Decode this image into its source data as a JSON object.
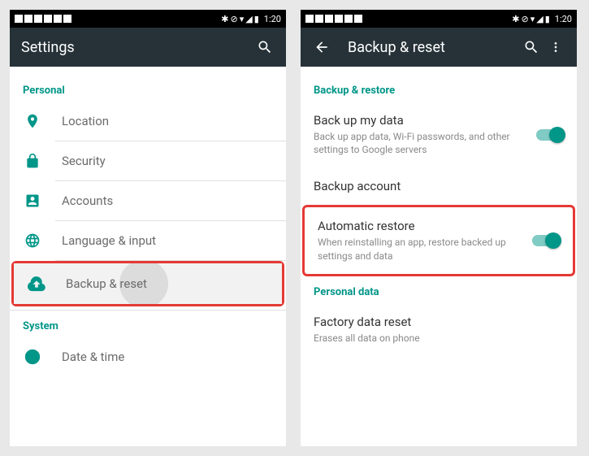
{
  "status": {
    "clock": "1:20"
  },
  "left": {
    "title": "Settings",
    "sections": {
      "personal": {
        "header": "Personal",
        "items": {
          "location": "Location",
          "security": "Security",
          "accounts": "Accounts",
          "language": "Language & input",
          "backup": "Backup & reset"
        }
      },
      "system": {
        "header": "System",
        "items": {
          "datetime": "Date & time"
        }
      }
    }
  },
  "right": {
    "title": "Backup & reset",
    "sections": {
      "backup": {
        "header": "Backup & restore",
        "items": {
          "backup_data": {
            "title": "Back up my data",
            "subtitle": "Back up app data, Wi-Fi passwords, and other settings to Google servers"
          },
          "backup_account": {
            "title": "Backup account"
          },
          "auto_restore": {
            "title": "Automatic restore",
            "subtitle": "When reinstalling an app, restore backed up settings and data"
          }
        }
      },
      "personal_data": {
        "header": "Personal data",
        "items": {
          "factory_reset": {
            "title": "Factory data reset",
            "subtitle": "Erases all data on phone"
          }
        }
      }
    }
  }
}
